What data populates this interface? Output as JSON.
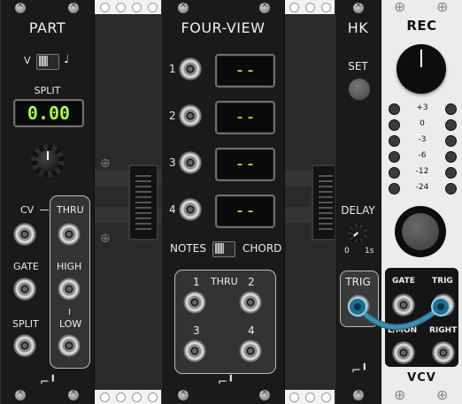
{
  "part": {
    "title": "PART",
    "switch_left": "V",
    "switch_right": "♩",
    "split_label": "SPLIT",
    "split_value": "0.00",
    "cv_label": "CV",
    "gate_label": "GATE",
    "split_in_label": "SPLIT",
    "thru_label": "THRU",
    "high_label": "HIGH",
    "low_label": "LOW"
  },
  "four_view": {
    "title": "FOUR-VIEW",
    "rows": [
      {
        "num": "1",
        "display": "--"
      },
      {
        "num": "2",
        "display": "--"
      },
      {
        "num": "3",
        "display": "--"
      },
      {
        "num": "4",
        "display": "--"
      }
    ],
    "mode_left": "NOTES",
    "mode_right": "CHORD",
    "out_1": "1",
    "out_thru": "THRU",
    "out_2": "2",
    "out_3": "3",
    "out_4": "4"
  },
  "hk": {
    "title": "HK",
    "set_label": "SET",
    "delay_label": "DELAY",
    "delay_min": "0",
    "delay_max": "1s",
    "trig_label": "TRIG"
  },
  "rec": {
    "title": "REC",
    "meter_labels": [
      "+3",
      "0",
      "-3",
      "-6",
      "-12",
      "-24"
    ],
    "gate_label": "GATE",
    "trig_label": "TRIG",
    "lmon_label": "L/MON",
    "right_label": "RIGHT",
    "brand": "VCV"
  },
  "colors": {
    "display_on": "#a6ff3c",
    "cable": "#3b8fb0"
  }
}
